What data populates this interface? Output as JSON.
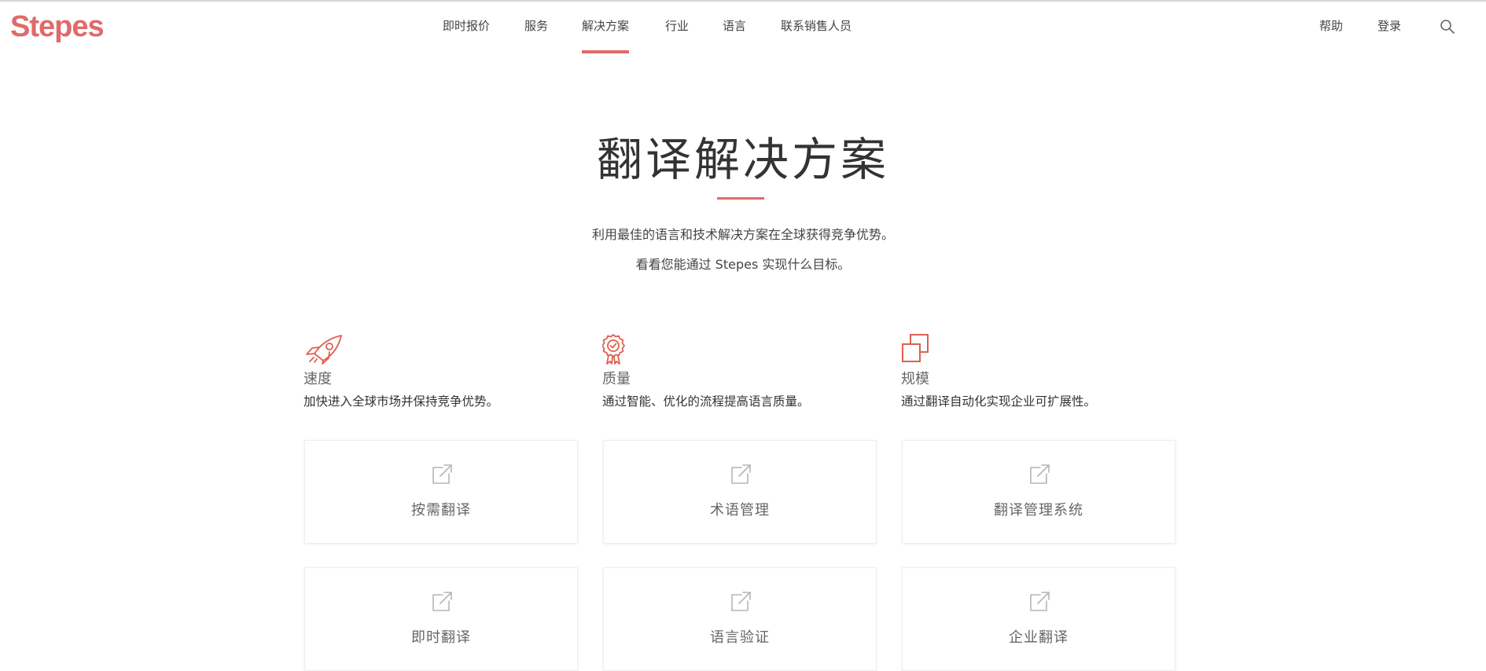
{
  "header": {
    "logo": "Stepes",
    "nav": [
      {
        "label": "即时报价"
      },
      {
        "label": "服务"
      },
      {
        "label": "解决方案",
        "active": true
      },
      {
        "label": "行业"
      },
      {
        "label": "语言"
      },
      {
        "label": "联系销售人员"
      }
    ],
    "help": "帮助",
    "login": "登录",
    "search_icon": "search-icon"
  },
  "hero": {
    "title": "翻译解决方案",
    "line1": "利用最佳的语言和技术解决方案在全球获得竞争优势。",
    "line2": "看看您能通过 Stepes 实现什么目标。"
  },
  "features": [
    {
      "icon": "rocket-icon",
      "title": "速度",
      "desc": "加快进入全球市场并保持竞争优势。"
    },
    {
      "icon": "award-icon",
      "title": "质量",
      "desc": "通过智能、优化的流程提高语言质量。"
    },
    {
      "icon": "scale-icon",
      "title": "规模",
      "desc": "通过翻译自动化实现企业可扩展性。"
    }
  ],
  "cards": [
    {
      "icon": "external-link-icon",
      "label": "按需翻译"
    },
    {
      "icon": "external-link-icon",
      "label": "术语管理"
    },
    {
      "icon": "external-link-icon",
      "label": "翻译管理系统"
    },
    {
      "icon": "external-link-icon",
      "label": "即时翻译"
    },
    {
      "icon": "external-link-icon",
      "label": "语言验证"
    },
    {
      "icon": "external-link-icon",
      "label": "企业翻译"
    }
  ],
  "colors": {
    "accent": "#e06a6a",
    "icon_accent": "#e0604f",
    "text": "#333333",
    "muted": "#666666",
    "card_icon": "#b5b5b5"
  }
}
